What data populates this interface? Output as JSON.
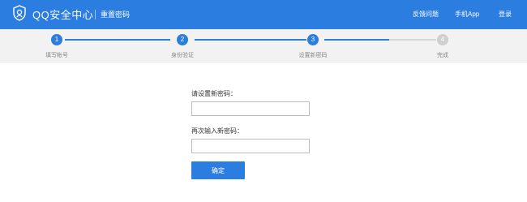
{
  "header": {
    "brand": "QQ安全中心",
    "subtitle": "重置密码",
    "nav": [
      {
        "label": "反馈问题"
      },
      {
        "label": "手机App"
      },
      {
        "label": "登录"
      }
    ],
    "bg_color": "#2b7de0"
  },
  "steps": {
    "items": [
      {
        "num": "1",
        "label": "填写帐号",
        "state": "done"
      },
      {
        "num": "2",
        "label": "身份验证",
        "state": "done"
      },
      {
        "num": "3",
        "label": "设置新密码",
        "state": "current"
      },
      {
        "num": "4",
        "label": "完成",
        "state": "todo"
      }
    ],
    "active_color": "#2b7de0",
    "inactive_color": "#cfcfcf"
  },
  "form": {
    "new_password_label": "请设置新密码：",
    "new_password_value": "",
    "confirm_password_label": "再次输入新密码：",
    "confirm_password_value": "",
    "submit_label": "确定"
  }
}
